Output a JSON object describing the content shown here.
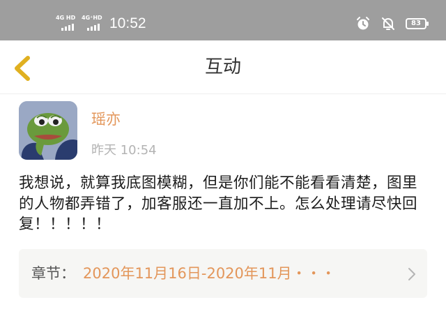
{
  "status_bar": {
    "signal_1_label": "4G HD",
    "signal_2_label": "4G⁺HD",
    "time": "10:52",
    "battery": "83",
    "icons": [
      "alarm-icon",
      "mute-icon",
      "battery-icon"
    ]
  },
  "nav": {
    "back_icon": "chevron-left-icon",
    "title": "互动"
  },
  "comment": {
    "avatar": "pepe-frog-avatar",
    "username": "瑶亦",
    "timestamp": "昨天 10:54",
    "text": "我想说，就算我底图模糊，但是你们能不能看看清楚，图里的人物都弄错了，加客服还一直加不上。怎么处理请尽快回复！！！！！"
  },
  "chapter": {
    "label": "章节：",
    "value": "2020年11月16日-2020年11月・・・",
    "arrow_icon": "chevron-right-icon"
  },
  "colors": {
    "status_bar_bg": "#9e9e9e",
    "accent": "#e3965a",
    "back_icon": "#e0b020",
    "chapter_bg": "#f6f6f4"
  }
}
